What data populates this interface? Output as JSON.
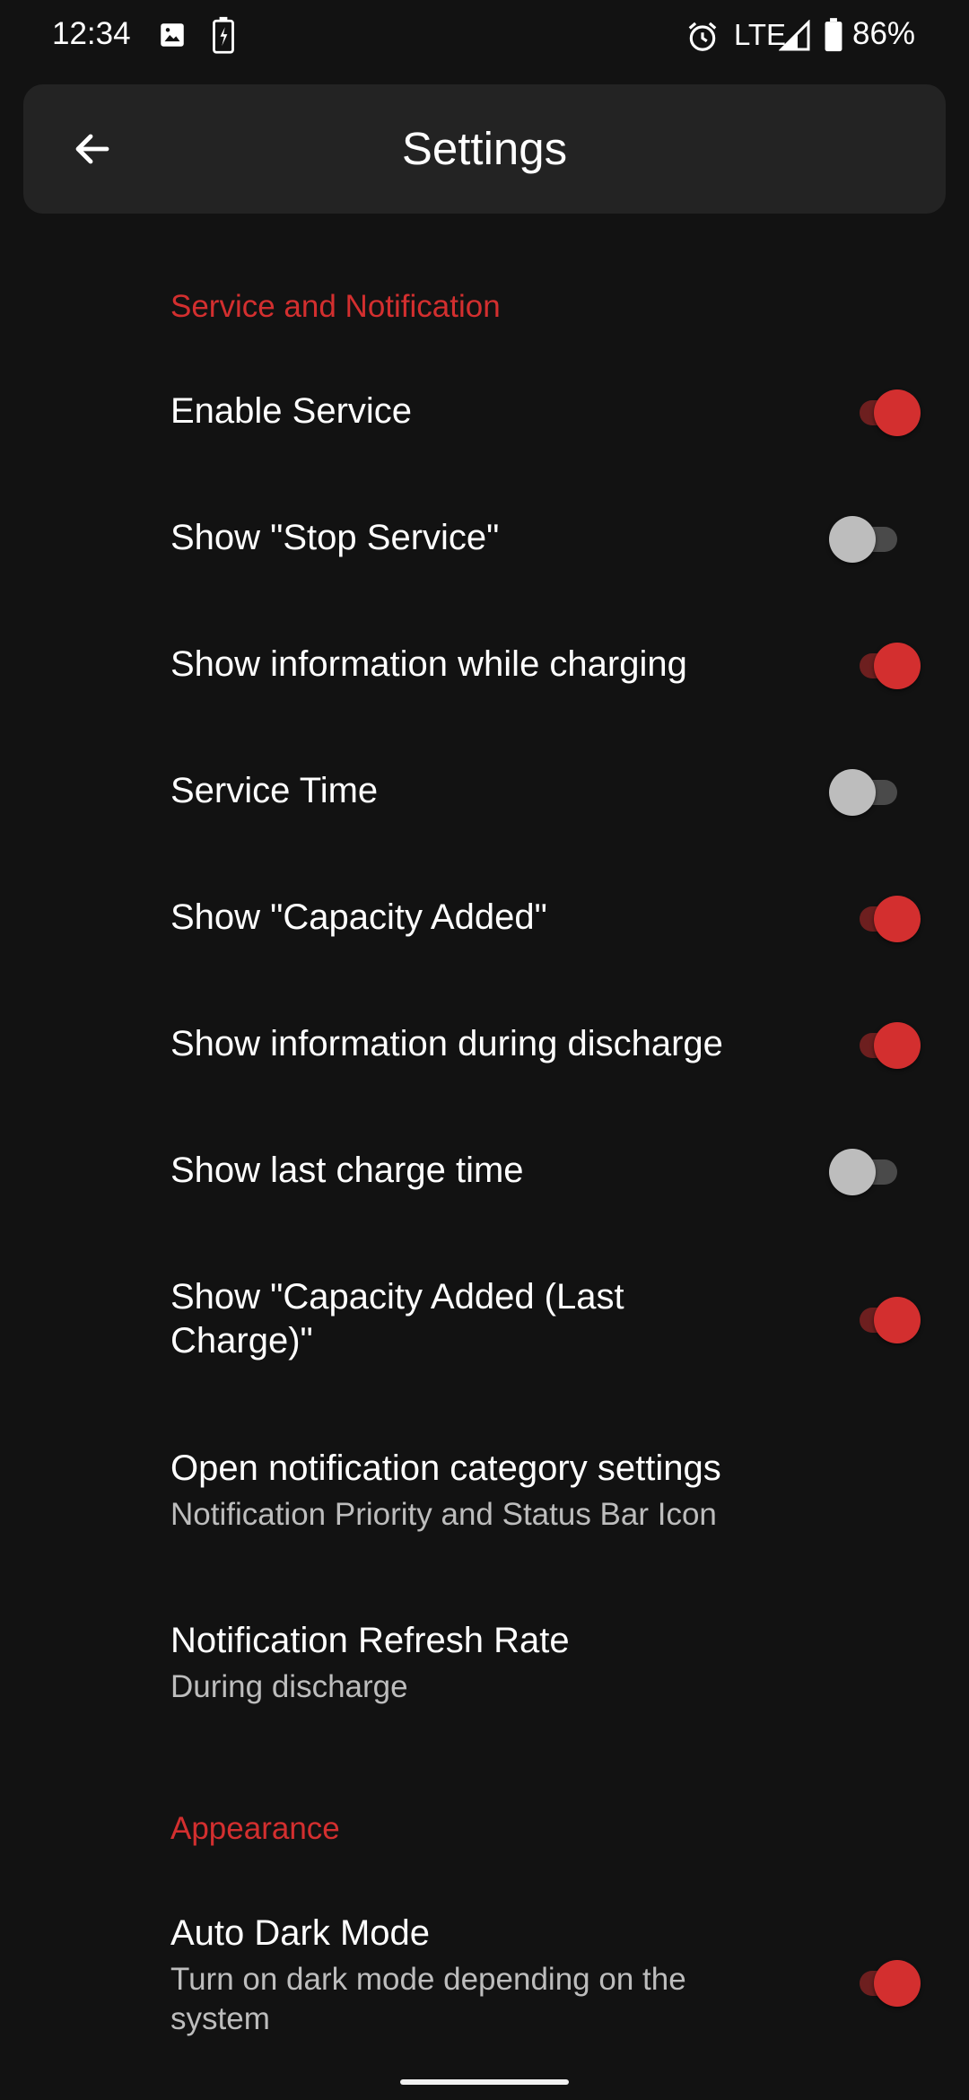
{
  "status_bar": {
    "time": "12:34",
    "network": "LTE",
    "battery": "86%",
    "icons": [
      "image-icon",
      "battery-charging-icon",
      "alarm-icon",
      "signal-icon",
      "battery-icon"
    ]
  },
  "app_bar": {
    "title": "Settings",
    "back_icon": "arrow-back-icon"
  },
  "colors": {
    "accent": "#d32f2f",
    "background": "#121212",
    "app_bar": "#232323"
  },
  "sections": [
    {
      "header": "Service and Notification",
      "items": [
        {
          "title": "Enable Service",
          "switch": true
        },
        {
          "title": "Show \"Stop Service\"",
          "switch": false
        },
        {
          "title": "Show information while charging",
          "switch": true
        },
        {
          "title": "Service Time",
          "switch": false
        },
        {
          "title": "Show \"Capacity Added\"",
          "switch": true
        },
        {
          "title": "Show information during discharge",
          "switch": true
        },
        {
          "title": "Show last charge time",
          "switch": false
        },
        {
          "title": "Show \"Capacity Added (Last Charge)\"",
          "switch": true
        },
        {
          "title": "Open notification category settings",
          "summary": "Notification Priority and Status Bar Icon"
        },
        {
          "title": "Notification Refresh Rate",
          "summary": "During discharge"
        }
      ]
    },
    {
      "header": "Appearance",
      "items": [
        {
          "title": "Auto Dark Mode",
          "summary": "Turn on dark mode depending on the system",
          "switch": true
        }
      ]
    }
  ]
}
